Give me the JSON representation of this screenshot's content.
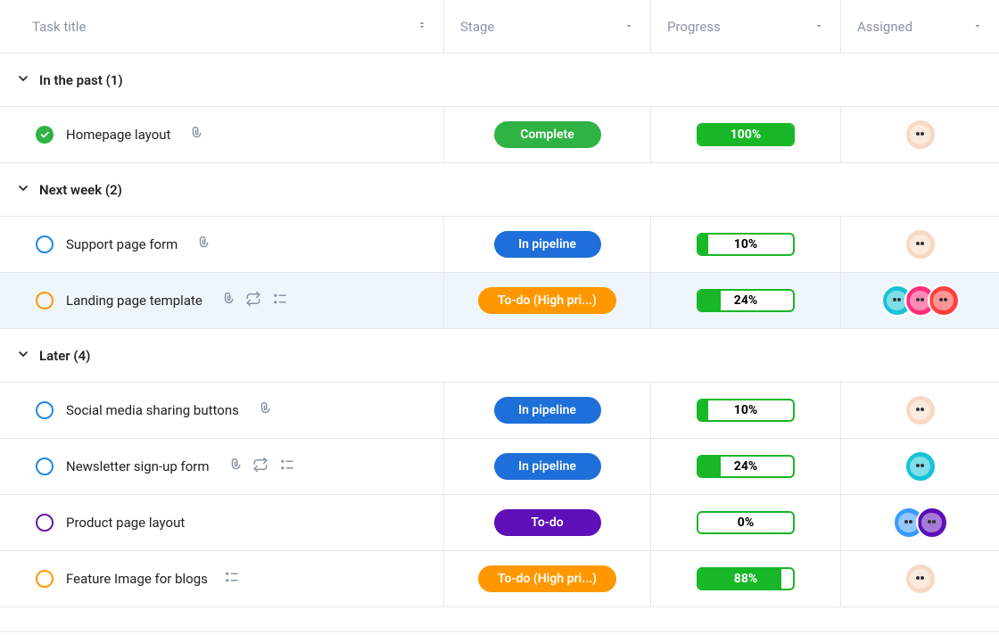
{
  "headers": {
    "task_title": "Task title",
    "stage": "Stage",
    "progress": "Progress",
    "assigned": "Assigned"
  },
  "groups": [
    {
      "label": "In the past (1)",
      "tasks": [
        {
          "status": "complete",
          "title": "Homepage layout",
          "icons": [
            "attachment"
          ],
          "stage_label": "Complete",
          "stage_color": "green",
          "progress": 100,
          "progress_label": "100%",
          "progress_label_white": true,
          "avatars": [
            "peach"
          ],
          "selected": false
        }
      ]
    },
    {
      "label": "Next week (2)",
      "tasks": [
        {
          "status": "blue",
          "title": "Support page form",
          "icons": [
            "attachment"
          ],
          "stage_label": "In pipeline",
          "stage_color": "blue",
          "progress": 10,
          "progress_label": "10%",
          "progress_label_white": false,
          "avatars": [
            "peach"
          ],
          "selected": false
        },
        {
          "status": "orange",
          "title": "Landing page template",
          "icons": [
            "attachment",
            "recurring",
            "subtasks"
          ],
          "stage_label": "To-do (High pri...)",
          "stage_color": "orange",
          "progress": 24,
          "progress_label": "24%",
          "progress_label_white": false,
          "avatars": [
            "teal",
            "pink",
            "red"
          ],
          "selected": true
        }
      ]
    },
    {
      "label": "Later (4)",
      "tasks": [
        {
          "status": "blue",
          "title": "Social media sharing buttons",
          "icons": [
            "attachment"
          ],
          "stage_label": "In pipeline",
          "stage_color": "blue",
          "progress": 10,
          "progress_label": "10%",
          "progress_label_white": false,
          "avatars": [
            "peach"
          ],
          "selected": false
        },
        {
          "status": "blue",
          "title": "Newsletter sign-up form",
          "icons": [
            "attachment",
            "recurring",
            "subtasks"
          ],
          "stage_label": "In pipeline",
          "stage_color": "blue",
          "progress": 24,
          "progress_label": "24%",
          "progress_label_white": false,
          "avatars": [
            "teal"
          ],
          "selected": false
        },
        {
          "status": "purple",
          "title": "Product page layout",
          "icons": [],
          "stage_label": "To-do",
          "stage_color": "purple",
          "progress": 0,
          "progress_label": "0%",
          "progress_label_white": false,
          "avatars": [
            "blue",
            "purple"
          ],
          "selected": false
        },
        {
          "status": "orange",
          "title": "Feature Image for blogs",
          "icons": [
            "subtasks"
          ],
          "stage_label": "To-do (High pri...)",
          "stage_color": "orange",
          "progress": 88,
          "progress_label": "88%",
          "progress_label_white": true,
          "avatars": [
            "peach"
          ],
          "selected": false
        }
      ]
    }
  ]
}
